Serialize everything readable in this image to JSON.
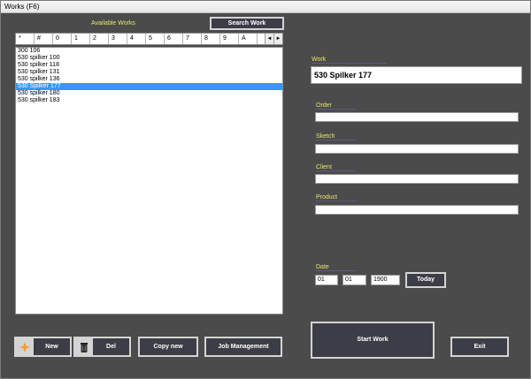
{
  "window": {
    "title": "Works (F6)"
  },
  "list_panel": {
    "label": "Available Works",
    "search_button": "Search Work",
    "alpha_tabs": [
      "*",
      "#",
      "0",
      "1",
      "2",
      "3",
      "4",
      "5",
      "6",
      "7",
      "8",
      "9",
      "A"
    ],
    "scroll_left": "◄",
    "scroll_right": "►",
    "items": [
      "300 106",
      "530 spilker 100",
      "530 spilker 118",
      "530 spilker 131",
      "530 spilker 136",
      "530 Spilker 177",
      "530 spilker 180",
      "530 spilker 183"
    ],
    "selected_index": 5
  },
  "form": {
    "work_label": "Work",
    "work_value": "530 Spilker 177",
    "order_label": "Order",
    "sketch_label": "Sketch",
    "client_label": "Client",
    "product_label": "Product",
    "date_label": "Date",
    "date_day": "01",
    "date_month": "01",
    "date_year": "1900",
    "today_button": "Today"
  },
  "buttons": {
    "new": "New",
    "del": "Del",
    "copy_new": "Copy new",
    "job_management": "Job Management",
    "start_work": "Start Work",
    "exit": "Exit"
  },
  "icons": {
    "new": "plus-star-icon",
    "del": "trash-bin-icon"
  },
  "colors": {
    "background": "#4b4b4b",
    "label": "#e9e46a",
    "button": "#3d3d47",
    "selection": "#3399ff"
  }
}
